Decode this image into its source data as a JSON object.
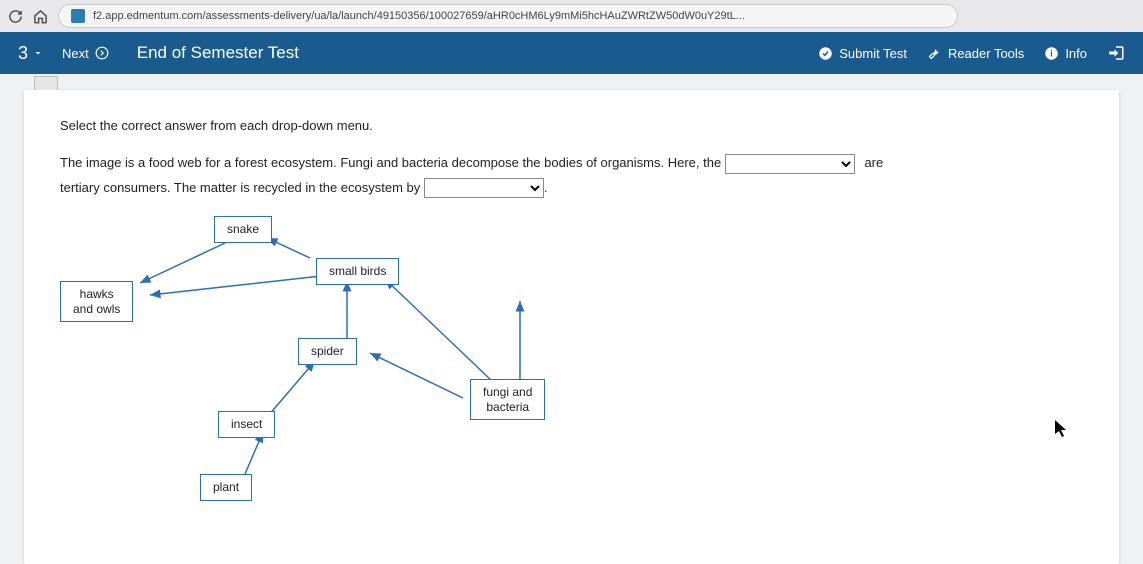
{
  "browser": {
    "url": "f2.app.edmentum.com/assessments-delivery/ua/la/launch/49150356/100027659/aHR0cHM6Ly9mMi5hcHAuZWRtZW50dW0uY29tL..."
  },
  "header": {
    "question_num": "3",
    "next_label": "Next",
    "title": "End of Semester Test",
    "submit": "Submit Test",
    "reader_tools": "Reader Tools",
    "info": "Info"
  },
  "question": {
    "instruction": "Select the correct answer from each drop-down menu.",
    "text1": "The image is a food web for a forest ecosystem. Fungi and bacteria decompose the bodies of organisms. Here, the",
    "text_after1": "are",
    "text2": "tertiary consumers. The matter is recycled in the ecosystem by"
  },
  "nodes": {
    "snake": "snake",
    "hawks": "hawks\nand owls",
    "smallbirds": "small birds",
    "spider": "spider",
    "fungi": "fungi and\nbacteria",
    "insect": "insect",
    "plant": "plant"
  }
}
